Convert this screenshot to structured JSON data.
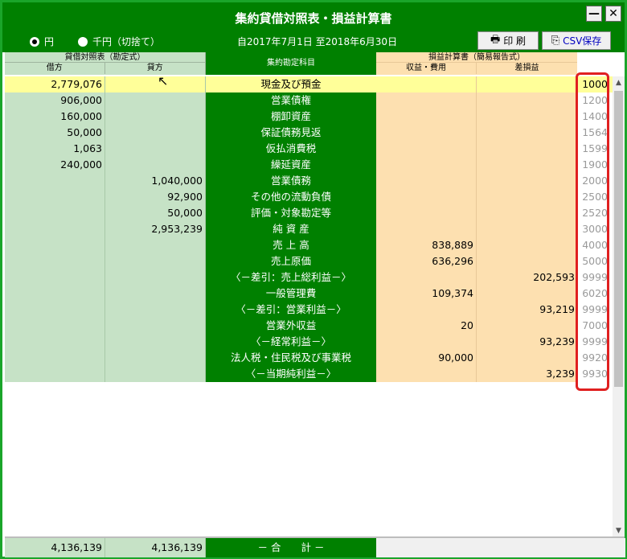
{
  "window": {
    "title": "集約貸借対照表・損益計算書",
    "min_label": "—",
    "close_label": "✕"
  },
  "options": {
    "yen_label": "円",
    "thousand_label": "千円（切捨て）"
  },
  "period": "自2017年7月1日 至2018年6月30日",
  "buttons": {
    "print_label": "印 刷",
    "csv_label": "CSV保存"
  },
  "header": {
    "bs_group": "貸借対照表（勘定式）",
    "debit": "借方",
    "credit": "貸方",
    "account": "集約勘定科目",
    "pl_group": "損益計算書（簡易報告式）",
    "revenue_expense": "収益・費用",
    "difference": "差損益"
  },
  "rows": [
    {
      "debit": "2,779,076",
      "credit": "",
      "account": "現金及び預金",
      "rev": "",
      "diff": "",
      "code": "1000"
    },
    {
      "debit": "906,000",
      "credit": "",
      "account": "営業債権",
      "rev": "",
      "diff": "",
      "code": "1200"
    },
    {
      "debit": "160,000",
      "credit": "",
      "account": "棚卸資産",
      "rev": "",
      "diff": "",
      "code": "1400"
    },
    {
      "debit": "50,000",
      "credit": "",
      "account": "保証債務見返",
      "rev": "",
      "diff": "",
      "code": "1564"
    },
    {
      "debit": "1,063",
      "credit": "",
      "account": "仮払消費税",
      "rev": "",
      "diff": "",
      "code": "1599"
    },
    {
      "debit": "240,000",
      "credit": "",
      "account": "繰延資産",
      "rev": "",
      "diff": "",
      "code": "1900"
    },
    {
      "debit": "",
      "credit": "1,040,000",
      "account": "営業債務",
      "rev": "",
      "diff": "",
      "code": "2000"
    },
    {
      "debit": "",
      "credit": "92,900",
      "account": "その他の流動負債",
      "rev": "",
      "diff": "",
      "code": "2500"
    },
    {
      "debit": "",
      "credit": "50,000",
      "account": "評価・対象勘定等",
      "rev": "",
      "diff": "",
      "code": "2520"
    },
    {
      "debit": "",
      "credit": "2,953,239",
      "account": "純 資 産",
      "rev": "",
      "diff": "",
      "code": "3000"
    },
    {
      "debit": "",
      "credit": "",
      "account": "売 上 高",
      "rev": "838,889",
      "diff": "",
      "code": "4000"
    },
    {
      "debit": "",
      "credit": "",
      "account": "売上原価",
      "rev": "636,296",
      "diff": "",
      "code": "5000"
    },
    {
      "debit": "",
      "credit": "",
      "account": "〈－差引：売上総利益－〉",
      "rev": "",
      "diff": "202,593",
      "code": "9999"
    },
    {
      "debit": "",
      "credit": "",
      "account": "一般管理費",
      "rev": "109,374",
      "diff": "",
      "code": "6020"
    },
    {
      "debit": "",
      "credit": "",
      "account": "〈－差引：営業利益－〉",
      "rev": "",
      "diff": "93,219",
      "code": "9999"
    },
    {
      "debit": "",
      "credit": "",
      "account": "営業外収益",
      "rev": "20",
      "diff": "",
      "code": "7000"
    },
    {
      "debit": "",
      "credit": "",
      "account": "〈－経常利益－〉",
      "rev": "",
      "diff": "93,239",
      "code": "9999"
    },
    {
      "debit": "",
      "credit": "",
      "account": "法人税・住民税及び事業税",
      "rev": "90,000",
      "diff": "",
      "code": "9920"
    },
    {
      "debit": "",
      "credit": "",
      "account": "〈－当期純利益－〉",
      "rev": "",
      "diff": "3,239",
      "code": "9930"
    }
  ],
  "footer": {
    "debit_total": "4,136,139",
    "credit_total": "4,136,139",
    "label": "－ 合　　計 －"
  },
  "colors": {
    "title_bg": "#008000",
    "bs_bg": "#c6e2c6",
    "pl_bg": "#fde0b0",
    "selected_bg": "#ffff99",
    "highlight_box": "#e02020"
  }
}
